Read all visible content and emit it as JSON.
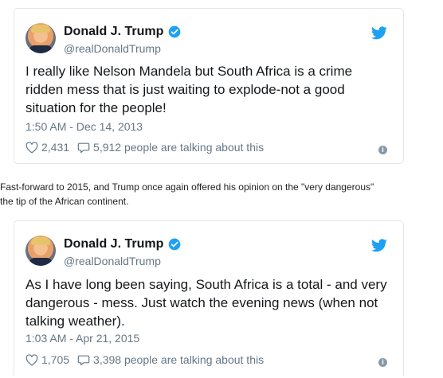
{
  "tweets": [
    {
      "name": "Donald J. Trump",
      "handle": "@realDonaldTrump",
      "text": "I really like Nelson Mandela but South Africa is a crime ridden mess that is just waiting to explode-not a good situation for the people!",
      "time": "1:50 AM - Dec 14, 2013",
      "likes": "2,431",
      "talking": "5,912 people are talking about this"
    },
    {
      "name": "Donald J. Trump",
      "handle": "@realDonaldTrump",
      "text": "As I have long been saying, South Africa is a total - and very dangerous - mess. Just watch the evening news (when not talking weather).",
      "time": "1:03 AM - Apr 21, 2015",
      "likes": "1,705",
      "talking": "3,398 people are talking about this"
    }
  ],
  "caption": "Fast-forward to 2015, and Trump once again offered his opinion on the \"very dangerous\"\nthe tip of the African continent.",
  "icons": {
    "verified": "verified-badge-icon",
    "bird": "twitter-bird-icon",
    "heart": "heart-icon",
    "reply": "speech-bubble-icon",
    "info": "info-icon"
  },
  "colors": {
    "accent": "#1da1f2",
    "muted": "#657786",
    "border": "#e1e8ed",
    "info": "#8899a6"
  }
}
